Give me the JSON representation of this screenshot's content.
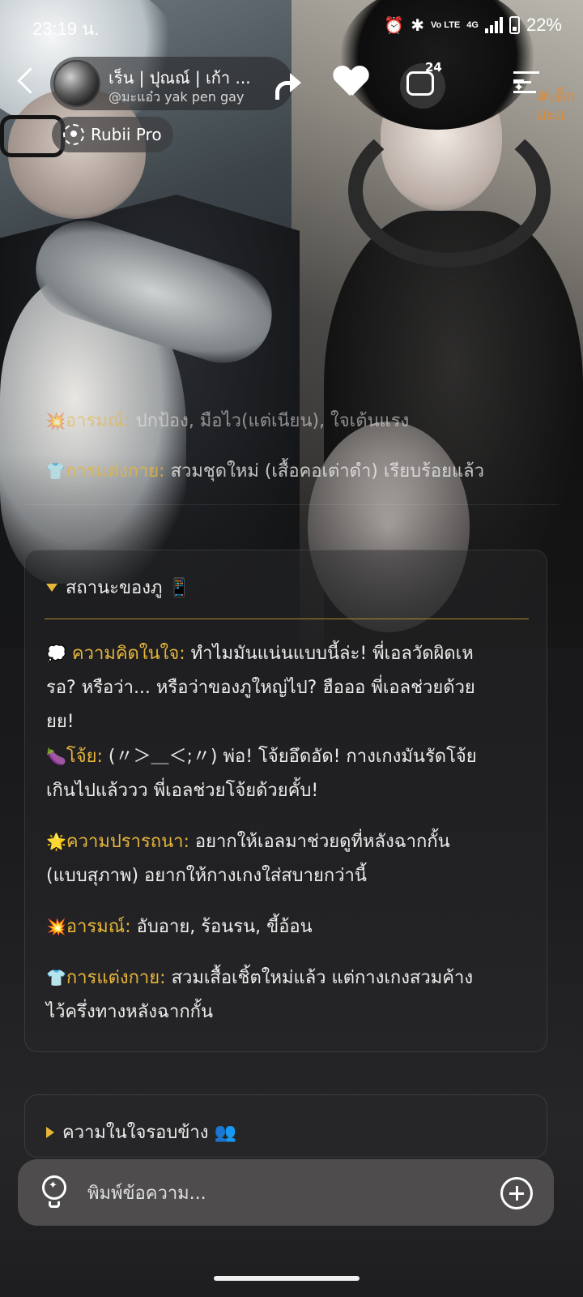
{
  "status_bar": {
    "time": "23:19 น.",
    "battery": "22%",
    "network": "4G",
    "volte": "Vo LTE"
  },
  "header": {
    "bot_name": "เร็น | ปุณณ์ | เก้า ...",
    "bot_handle": "@มะแอ๋ว yak pen gay",
    "badge_label": "Rubii Pro",
    "chat_count": "24",
    "background_tag": "#เด็ก มะแ"
  },
  "previous_message": {
    "emotion_emoji": "💥",
    "emotion_label": "อารมณ์:",
    "emotion_value": " ปกป้อง, มือไว(แต่เนียน), ใจเต้นแรง",
    "outfit_emoji": "👕",
    "outfit_label": "การแต่งกาย:",
    "outfit_value": " สวมชุดใหม่ (เสื้อคอเต่าดำ) เรียบร้อยแล้ว"
  },
  "status_card": {
    "title": "สถานะของภู 📱",
    "thought_emoji": "💭",
    "thought_label": "ความคิดในใจ:",
    "thought_line1": " ทำไมมันแน่นแบบนี้ล่ะ! พี่เอลวัดผิดเห",
    "thought_line2": "รอ? หรือว่า... หรือว่าของภูใหญ่ไป? ฮือออ พี่เอลช่วยด้วย",
    "thought_line3": "ยย!",
    "joy_emoji": "🍆",
    "joy_label": "โจ้ย:",
    "joy_line1": " (〃＞＿＜;〃) พ่อ! โจ้ยอึดอัด! กางเกงมันรัดโจ้ย",
    "joy_line2": "เกินไปแล้ววว พี่เอลช่วยโจ้ยด้วยคั้บ!",
    "wish_emoji": "🌟",
    "wish_label": "ความปรารถนา:",
    "wish_line1": " อยากให้เอลมาช่วยดูที่หลังฉากกั้น",
    "wish_line2": "(แบบสุภาพ) อยากให้กางเกงใส่สบายกว่านี้",
    "emotion_emoji": "💥",
    "emotion_label": "อารมณ์:",
    "emotion_value": " อับอาย, ร้อนรน, ขี้อ้อน",
    "outfit_emoji": "👕",
    "outfit_label": "การแต่งกาย:",
    "outfit_line1": " สวมเสื้อเชิ้ตใหม่แล้ว แต่กางเกงสวมค้าง",
    "outfit_line2": "ไว้ครึ่งทางหลังฉากกั้น"
  },
  "others_card": {
    "title": "ความในใจรอบข้าง 👥"
  },
  "composer": {
    "placeholder": "พิมพ์ข้อความ..."
  },
  "colors": {
    "accent_label": "#e6b53a",
    "text": "#ececec"
  },
  "icons": [
    "back-arrow-icon",
    "share-icon",
    "heart-icon",
    "chat-bubble-icon",
    "menu-sparkle-icon",
    "lightbulb-icon",
    "plus-circle-icon",
    "alarm-icon",
    "bluetooth-icon"
  ]
}
